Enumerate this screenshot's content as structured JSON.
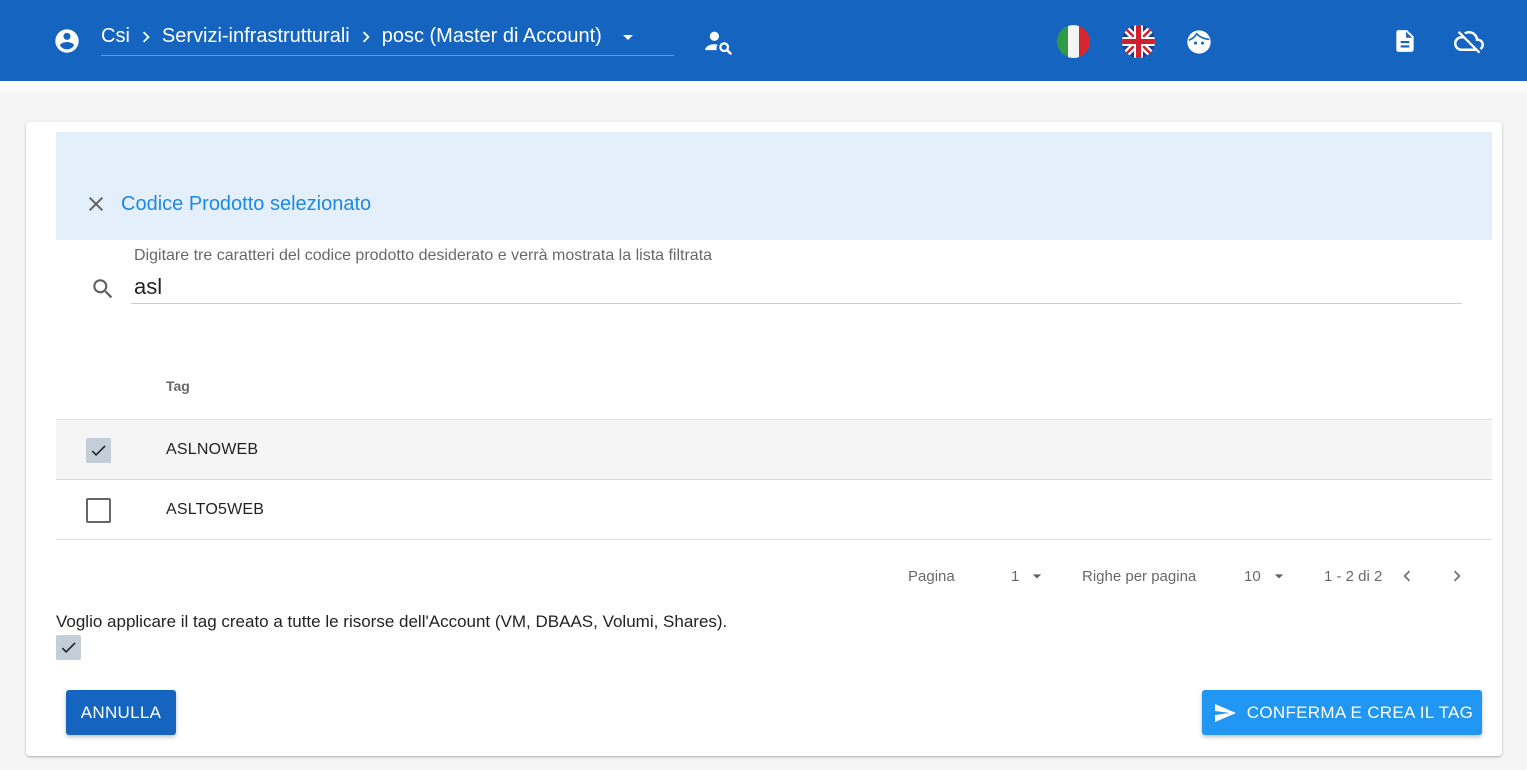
{
  "header": {
    "breadcrumb": [
      "Csi",
      "Servizi-infrastrutturali",
      "posc (Master di Account)"
    ],
    "icons": [
      "account-circle-icon",
      "chevron-right-icon",
      "dropdown-caret-icon",
      "user-search-icon",
      "italian-flag-icon",
      "uk-flag-icon",
      "face-icon",
      "document-icon",
      "cloud-off-icon"
    ],
    "bar_color": "#1565c0"
  },
  "banner": {
    "title": "Codice Prodotto selezionato",
    "title_color": "#1e88e5"
  },
  "search": {
    "label": "Digitare tre caratteri del codice prodotto desiderato e verrà mostrata la lista filtrata",
    "value": "asl"
  },
  "table": {
    "column_header": "Tag",
    "rows": [
      {
        "tag": "ASLNOWEB",
        "checked": true
      },
      {
        "tag": "ASLTO5WEB",
        "checked": false
      }
    ]
  },
  "pagination": {
    "page_label": "Pagina",
    "page_value": "1",
    "rows_label": "Righe per pagina",
    "rows_value": "10",
    "range": "1 - 2 di 2"
  },
  "apply": {
    "text": "Voglio applicare il tag creato a tutte le risorse dell'Account (VM, DBAAS, Volumi, Shares).",
    "checked": true
  },
  "buttons": {
    "cancel": "ANNULLA",
    "confirm": "CONFERMA E CREA IL TAG",
    "cancel_color": "#1565c0",
    "confirm_color": "#2196f3"
  }
}
